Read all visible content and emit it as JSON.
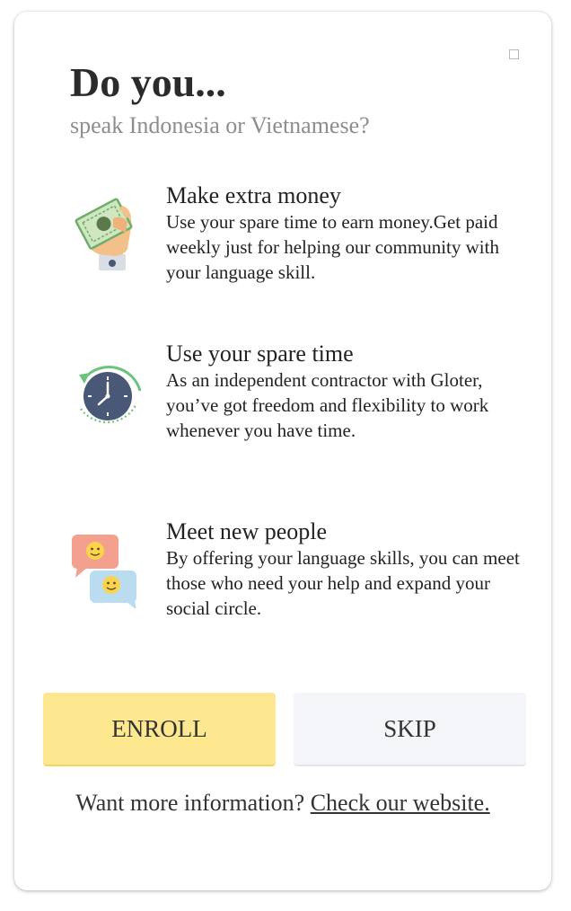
{
  "dialog": {
    "title": "Do you...",
    "subtitle": "speak Indonesia or Vietnamese?"
  },
  "features": [
    {
      "icon": "money-hand-icon",
      "title": "Make extra money",
      "description": "Use your spare time to earn money.Get paid weekly just for helping our community with your language skill."
    },
    {
      "icon": "clock-icon",
      "title": "Use your spare time",
      "description": "As an independent contractor with Gloter, you’ve got freedom and flexibility to work whenever you have time."
    },
    {
      "icon": "chat-bubbles-icon",
      "title": "Meet new people",
      "description": "By offering your language skills, you can meet those who need your help and expand your social circle."
    }
  ],
  "buttons": {
    "enroll_label": "ENROLL",
    "skip_label": "SKIP"
  },
  "footer": {
    "text": "Want more information?",
    "link_text": "Check our website."
  },
  "colors": {
    "enroll_bg": "#fde78f",
    "skip_bg": "#f4f5f9",
    "subtitle": "#8d8d8d",
    "clock_face": "#4a5878",
    "clock_arc": "#6cc27f"
  }
}
